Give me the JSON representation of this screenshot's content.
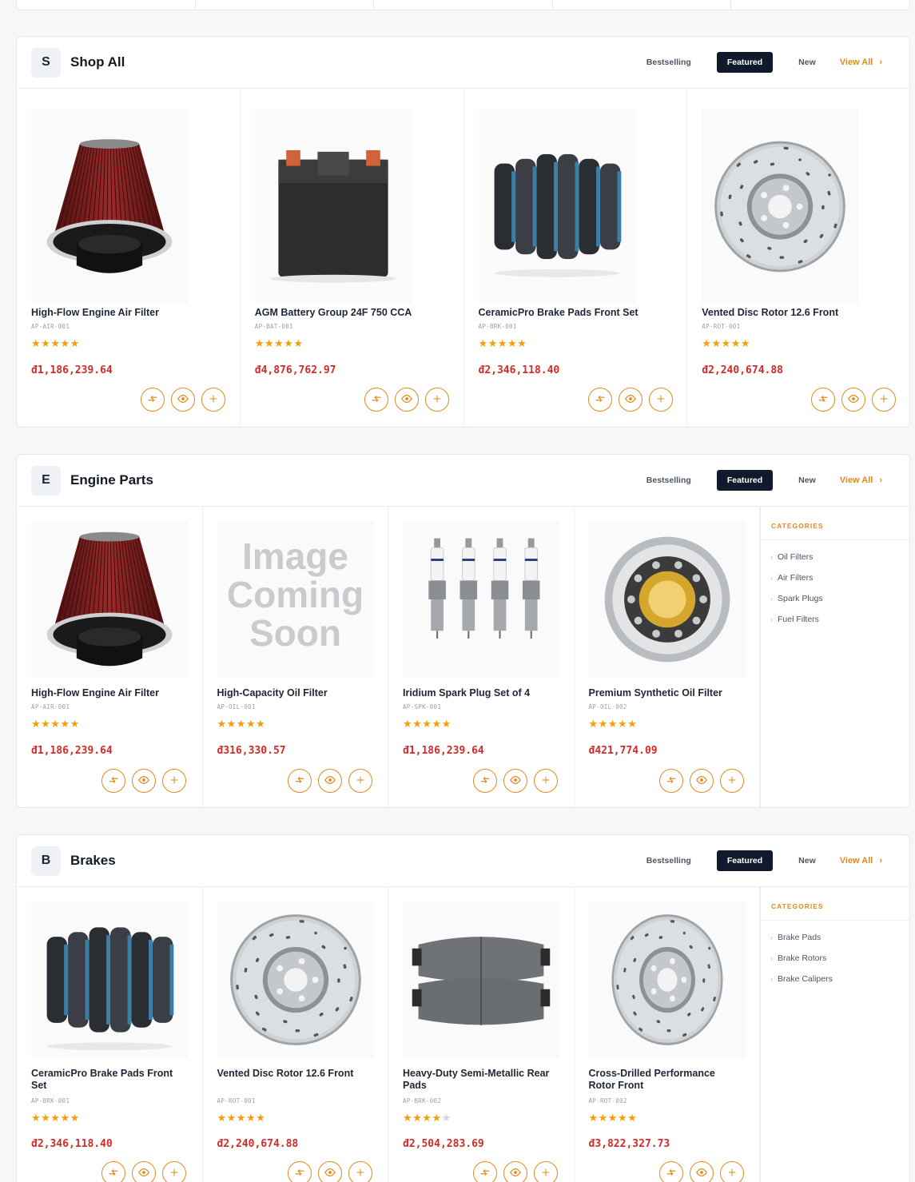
{
  "sections": [
    {
      "badge": "S",
      "title": "Shop All",
      "tabs": [
        "Bestselling",
        "Featured",
        "New"
      ],
      "active_tab": "Featured",
      "view_all": "View All",
      "products": [
        {
          "name": "High-Flow Engine Air Filter",
          "sku": "AP-AIR-001",
          "rating": 5,
          "price": "đ1,186,239.64",
          "image": "air-filter"
        },
        {
          "name": "AGM Battery Group 24F 750 CCA",
          "sku": "AP-BAT-001",
          "rating": 5,
          "price": "đ4,876,762.97",
          "image": "battery"
        },
        {
          "name": "CeramicPro Brake Pads Front Set",
          "sku": "AP-BRK-001",
          "rating": 5,
          "price": "đ2,346,118.40",
          "image": "brake-pad-stack"
        },
        {
          "name": "Vented Disc Rotor 12.6 Front",
          "sku": "AP-ROT-001",
          "rating": 5,
          "price": "đ2,240,674.88",
          "image": "disc-rotor"
        }
      ]
    },
    {
      "badge": "E",
      "title": "Engine Parts",
      "tabs": [
        "Bestselling",
        "Featured",
        "New"
      ],
      "active_tab": "Featured",
      "view_all": "View All",
      "categories_title": "CATEGORIES",
      "categories": [
        "Oil Filters",
        "Air Filters",
        "Spark Plugs",
        "Fuel Filters"
      ],
      "products": [
        {
          "name": "High-Flow Engine Air Filter",
          "sku": "AP-AIR-001",
          "rating": 5,
          "price": "đ1,186,239.64",
          "image": "air-filter"
        },
        {
          "name": "High-Capacity Oil Filter",
          "sku": "AP-OIL-001",
          "rating": 5,
          "price": "đ316,330.57",
          "image": "placeholder",
          "placeholder_text": "Image Coming Soon"
        },
        {
          "name": "Iridium Spark Plug Set of 4",
          "sku": "AP-SPK-001",
          "rating": 5,
          "price": "đ1,186,239.64",
          "image": "spark-plugs"
        },
        {
          "name": "Premium Synthetic Oil Filter",
          "sku": "AP-OIL-002",
          "rating": 5,
          "price": "đ421,774.09",
          "image": "oil-filter"
        }
      ]
    },
    {
      "badge": "B",
      "title": "Brakes",
      "tabs": [
        "Bestselling",
        "Featured",
        "New"
      ],
      "active_tab": "Featured",
      "view_all": "View All",
      "categories_title": "CATEGORIES",
      "categories": [
        "Brake Pads",
        "Brake Rotors",
        "Brake Calipers"
      ],
      "products": [
        {
          "name": "CeramicPro Brake Pads Front Set",
          "sku": "AP-BRK-001",
          "rating": 5,
          "price": "đ2,346,118.40",
          "image": "brake-pad-stack"
        },
        {
          "name": "Vented Disc Rotor 12.6 Front",
          "sku": "AP-ROT-001",
          "rating": 5,
          "price": "đ2,240,674.88",
          "image": "disc-rotor"
        },
        {
          "name": "Heavy-Duty Semi-Metallic Rear Pads",
          "sku": "AP-BRK-002",
          "rating": 4,
          "price": "đ2,504,283.69",
          "image": "brake-pads"
        },
        {
          "name": "Cross-Drilled Performance Rotor Front",
          "sku": "AP-ROT-002",
          "rating": 5,
          "price": "đ3,822,327.73",
          "image": "disc-rotor-angled"
        }
      ]
    }
  ],
  "action_icons": [
    "compare-icon",
    "eye-icon",
    "plus-icon"
  ],
  "colors": {
    "accent": "#e08a1e",
    "price": "#d42a2a",
    "dark": "#111a2c",
    "star": "#f59e0b"
  }
}
